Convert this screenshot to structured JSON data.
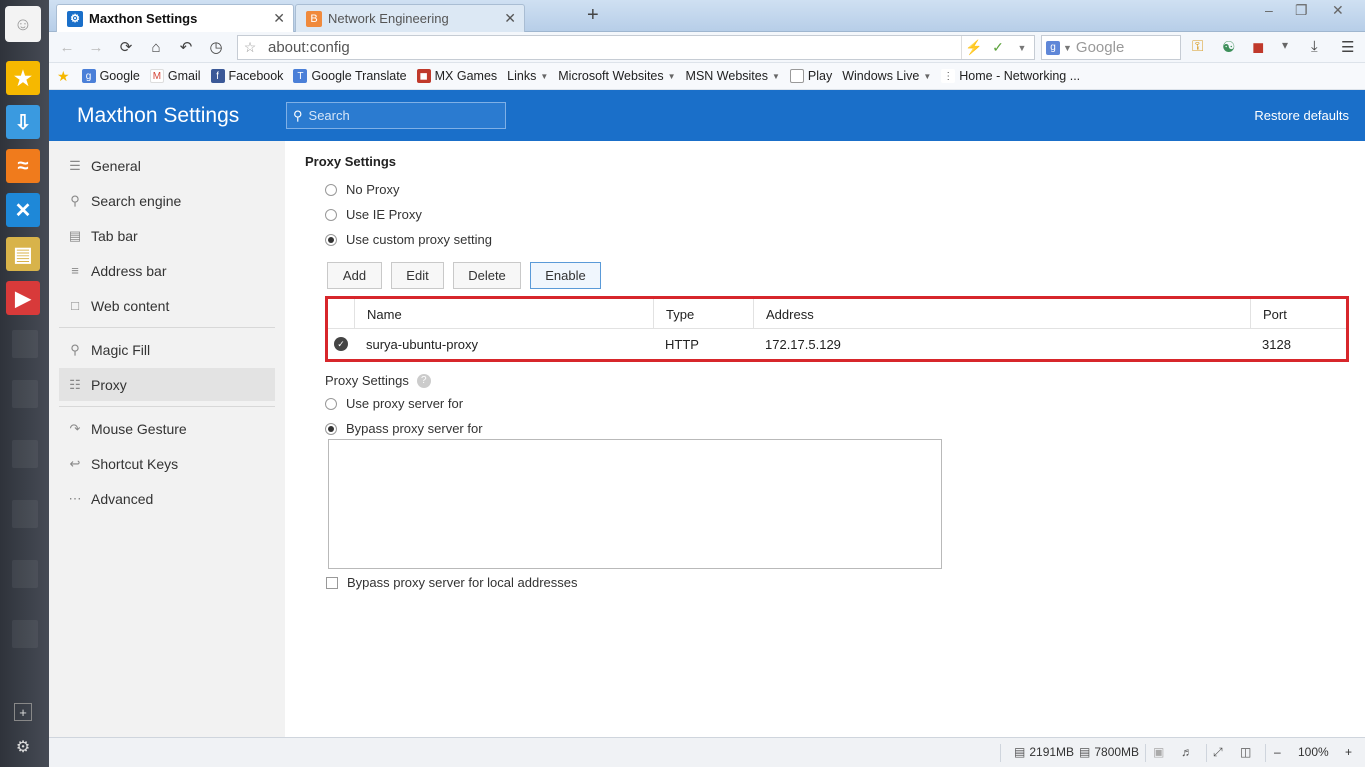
{
  "window": {
    "tabs": [
      {
        "label": "Maxthon Settings",
        "active": true,
        "icon": "gear-icon"
      },
      {
        "label": "Network Engineering",
        "active": false,
        "icon": "blogger-icon"
      }
    ],
    "new_tab": "+",
    "controls": {
      "minimize": "–",
      "restore": "❐",
      "close": "✕"
    }
  },
  "nav": {
    "url": "about:config",
    "search_placeholder": "Google"
  },
  "bookmarks": [
    {
      "label": "Google",
      "icon": "google-icon",
      "color": "#4a7fd8",
      "dropdown": false
    },
    {
      "label": "Gmail",
      "icon": "gmail-icon",
      "color": "#d44638",
      "dropdown": false
    },
    {
      "label": "Facebook",
      "icon": "facebook-icon",
      "color": "#3b5998",
      "dropdown": false
    },
    {
      "label": "Google Translate",
      "icon": "translate-icon",
      "color": "#4a7fd8",
      "dropdown": false
    },
    {
      "label": "MX Games",
      "icon": "games-icon",
      "color": "#c0392b",
      "dropdown": false
    },
    {
      "label": "Links",
      "icon": "",
      "color": "",
      "dropdown": true
    },
    {
      "label": "Microsoft Websites",
      "icon": "",
      "color": "",
      "dropdown": true
    },
    {
      "label": "MSN Websites",
      "icon": "",
      "color": "",
      "dropdown": true
    },
    {
      "label": "Play",
      "icon": "page-icon",
      "color": "#ffffff",
      "dropdown": false
    },
    {
      "label": "Windows Live",
      "icon": "",
      "color": "",
      "dropdown": true
    },
    {
      "label": "Home - Networking ...",
      "icon": "cisco-icon",
      "color": "#555555",
      "dropdown": false
    }
  ],
  "header": {
    "title": "Maxthon Settings",
    "search_placeholder": "Search",
    "restore": "Restore defaults"
  },
  "sidebar": {
    "items": [
      {
        "label": "General",
        "icon": "sliders-icon",
        "selected": false
      },
      {
        "label": "Search engine",
        "icon": "search-icon",
        "selected": false
      },
      {
        "label": "Tab bar",
        "icon": "tab-icon",
        "selected": false
      },
      {
        "label": "Address bar",
        "icon": "address-icon",
        "selected": false
      },
      {
        "label": "Web content",
        "icon": "page-icon",
        "selected": false
      },
      {
        "label": "Magic Fill",
        "icon": "wand-icon",
        "selected": false
      },
      {
        "label": "Proxy",
        "icon": "proxy-icon",
        "selected": true
      },
      {
        "label": "Mouse Gesture",
        "icon": "gesture-icon",
        "selected": false
      },
      {
        "label": "Shortcut Keys",
        "icon": "keys-icon",
        "selected": false
      },
      {
        "label": "Advanced",
        "icon": "ellipsis-icon",
        "selected": false
      }
    ]
  },
  "proxy": {
    "heading": "Proxy Settings",
    "modes": [
      {
        "label": "No Proxy",
        "checked": false
      },
      {
        "label": "Use IE Proxy",
        "checked": false
      },
      {
        "label": "Use custom proxy setting",
        "checked": true
      }
    ],
    "buttons": {
      "add": "Add",
      "edit": "Edit",
      "delete": "Delete",
      "enable": "Enable"
    },
    "table": {
      "columns": [
        "Name",
        "Type",
        "Address",
        "Port"
      ],
      "rows": [
        {
          "enabled": true,
          "name": "surya-ubuntu-proxy",
          "type": "HTTP",
          "address": "172.17.5.129",
          "port": "3128"
        }
      ]
    },
    "settings_heading": "Proxy Settings",
    "help": "?",
    "server_modes": [
      {
        "label": "Use proxy server for",
        "checked": false
      },
      {
        "label": "Bypass proxy server for",
        "checked": true
      }
    ],
    "bypass_list": "",
    "bypass_local": {
      "label": "Bypass proxy server for local addresses",
      "checked": false
    }
  },
  "status": {
    "memory": "2191MB",
    "ram": "7800MB",
    "zoom": "100%",
    "zoom_minus": "–",
    "zoom_plus": "+"
  },
  "colors": {
    "header_blue": "#1a6fc9",
    "highlight_red": "#d7262b"
  }
}
